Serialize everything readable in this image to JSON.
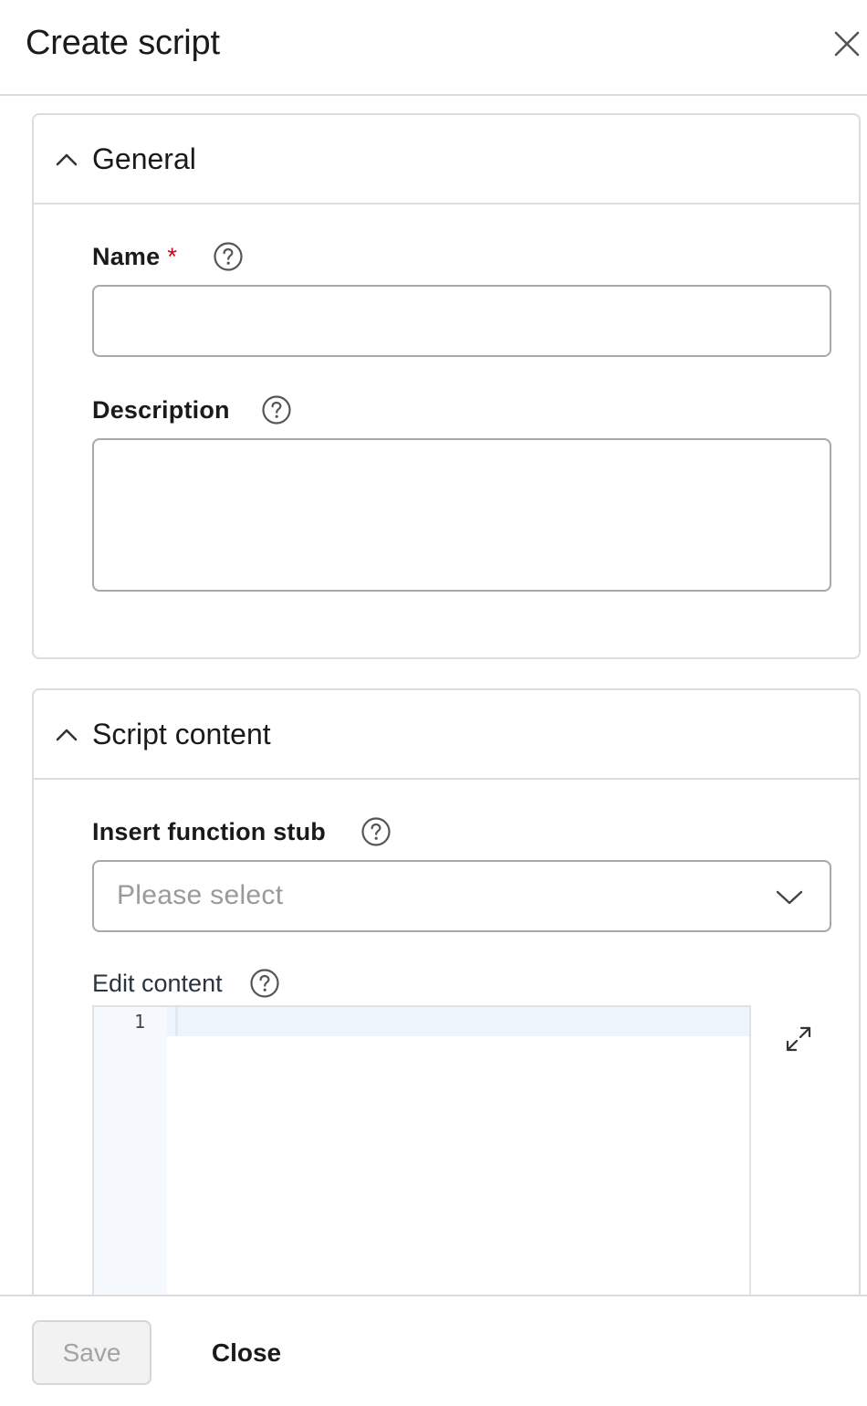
{
  "header": {
    "title": "Create script"
  },
  "general": {
    "title": "General",
    "name_label": "Name",
    "required_mark": "*",
    "name_value": "",
    "description_label": "Description",
    "description_value": ""
  },
  "script_content": {
    "title": "Script content",
    "stub_label": "Insert function stub",
    "stub_placeholder": "Please select",
    "edit_label": "Edit content",
    "line_numbers": [
      "1"
    ],
    "code": ""
  },
  "footer": {
    "save_label": "Save",
    "close_label": "Close"
  },
  "colors": {
    "required": "#d0021b",
    "border": "#dcdcdc",
    "placeholder": "#9a9a9a"
  }
}
